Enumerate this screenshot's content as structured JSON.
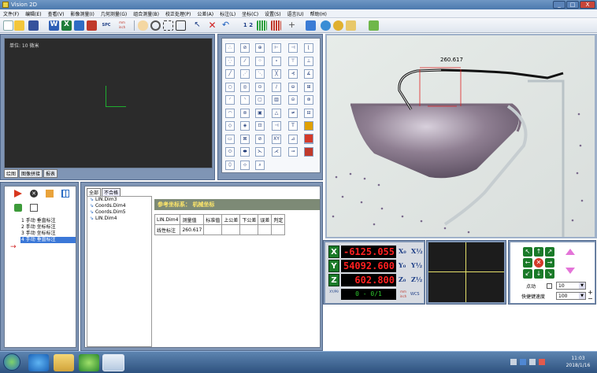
{
  "window": {
    "title": "Vision 2D",
    "controls": [
      "_",
      "□",
      "X"
    ]
  },
  "menu": [
    "文件(F)",
    "编辑(E)",
    "查看(V)",
    "影像测量(I)",
    "几何测量(G)",
    "组合测量(B)",
    "校正处理(P)",
    "公差(A)",
    "标注(L)",
    "坐标(C)",
    "设置(S)",
    "语言(U)",
    "帮助(H)"
  ],
  "toolbar": {
    "spc_label": "SPC",
    "unit_label": "mm inch",
    "num_label": "1 2"
  },
  "preview": {
    "unit_label": "单位: 10 微米",
    "tabs": [
      "绘图",
      "图像拼接",
      "报表"
    ]
  },
  "steps": {
    "items": [
      "1 手动 垂直标注",
      "2 手动 坐标标注",
      "3 手动 坐标标注",
      "4 手动 垂直标注"
    ],
    "selected_index": 3
  },
  "tree": {
    "tabs": [
      "全部",
      "不合格"
    ],
    "items": [
      "LIN.Dim3",
      "Coords.Dim4",
      "Coords.Dim5",
      "LIN.Dim4"
    ]
  },
  "results": {
    "ref_label": "参考坐标系：",
    "ref_value": "机械坐标",
    "headers": [
      "LIN.Dim4",
      "测量值",
      "标准值",
      "上公差",
      "下公差",
      "误差",
      "判定"
    ],
    "rows": [
      [
        "线性标注",
        "260.617",
        "",
        "",
        "",
        "",
        ""
      ]
    ]
  },
  "camera": {
    "measurement_label": "260.617"
  },
  "dro": {
    "x_label": "X",
    "x_value": "-6125.055",
    "y_label": "Y",
    "y_value": "54092.600",
    "z_label": "Z",
    "z_value": "602.800",
    "counter": "0 - 0/1",
    "mode_label": "XY/Pθ",
    "unit_label": "mm inch",
    "wcs_label": "WCS",
    "zero_labels": [
      "X₀",
      "Y₀",
      "Z₀"
    ],
    "half_labels": [
      "X½",
      "Y½",
      "Z½"
    ]
  },
  "jog": {
    "step_label": "点动",
    "step_value": "10",
    "speed_label": "快捷键速度",
    "speed_value": "100"
  },
  "taskbar": {
    "time": "11:03",
    "date": "2018/1/16"
  },
  "colors": {
    "accent_green": "#1a7a28",
    "dro_red": "#ff2020",
    "panel_blue": "#7f95b5",
    "selected_blue": "#3b78d8"
  }
}
